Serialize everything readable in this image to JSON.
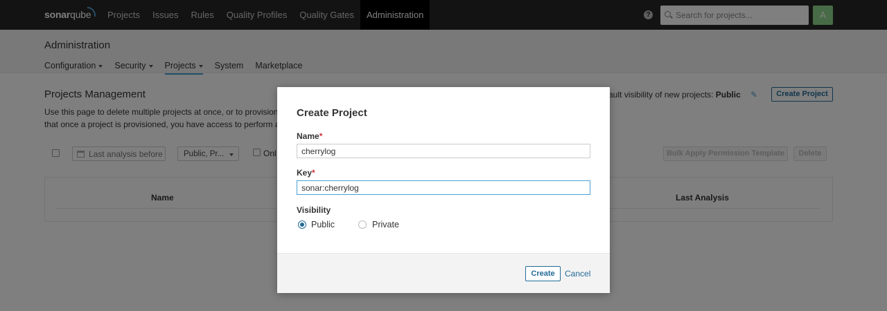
{
  "app": {
    "logo_bold": "sonar",
    "logo_light": "qube"
  },
  "topnav": {
    "items": [
      {
        "label": "Projects"
      },
      {
        "label": "Issues"
      },
      {
        "label": "Rules"
      },
      {
        "label": "Quality Profiles"
      },
      {
        "label": "Quality Gates"
      },
      {
        "label": "Administration",
        "active": true
      }
    ],
    "help_icon": "question-circle-icon",
    "search_placeholder": "Search for projects...",
    "avatar_letter": "A"
  },
  "page": {
    "title": "Administration",
    "subnav": [
      {
        "label": "Configuration",
        "dropdown": true
      },
      {
        "label": "Security",
        "dropdown": true
      },
      {
        "label": "Projects",
        "dropdown": true,
        "active": true
      },
      {
        "label": "System",
        "dropdown": false
      },
      {
        "label": "Marketplace",
        "dropdown": false
      }
    ]
  },
  "projects_management": {
    "title": "Projects Management",
    "description_line1": "Use this page to delete multiple projects at once, or to provision p",
    "description_line2": "that once a project is provisioned, you have access to perform all",
    "visibility_note_prefix": "efault visibility of new projects: ",
    "visibility_value": "Public",
    "create_project_label": "Create Project",
    "filters": {
      "date_placeholder": "Last analysis before",
      "visibility_select": "Public, Pr...",
      "only_label": "Onl"
    },
    "bulk_apply_label": "Bulk Apply Permission Template",
    "delete_label": "Delete",
    "table_headers": {
      "name": "Name",
      "last_analysis": "Last Analysis"
    }
  },
  "modal": {
    "title": "Create Project",
    "name_label": "Name",
    "name_value": "cherrylog",
    "key_label": "Key",
    "key_value": "sonar:cherrylog",
    "required_marker": "*",
    "visibility_label": "Visibility",
    "visibility_options": [
      {
        "label": "Public",
        "checked": true
      },
      {
        "label": "Private",
        "checked": false
      }
    ],
    "create_label": "Create",
    "cancel_label": "Cancel"
  },
  "colors": {
    "navbar_bg": "#262626",
    "accent_blue": "#236a97",
    "focus_blue": "#4b9fd5",
    "avatar_green": "#8fd68c",
    "required_red": "#d02f3a"
  }
}
